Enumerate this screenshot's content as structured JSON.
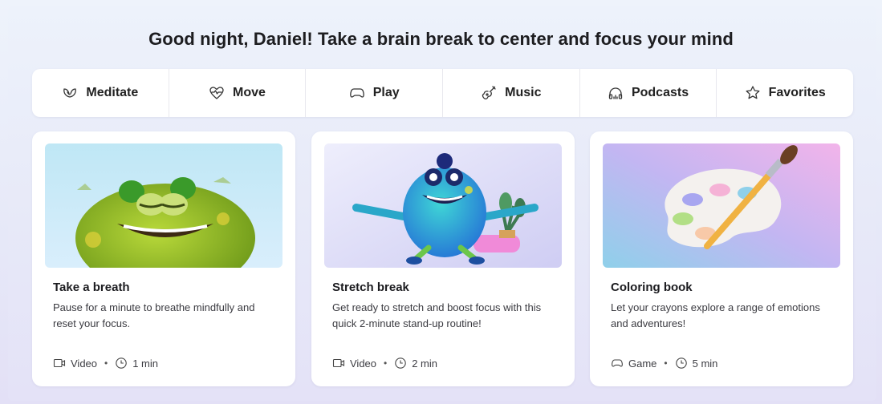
{
  "greeting": "Good night, Daniel! Take a brain break to center and focus your mind",
  "tabs": [
    {
      "label": "Meditate",
      "icon": "meditate-icon"
    },
    {
      "label": "Move",
      "icon": "heartbeat-icon"
    },
    {
      "label": "Play",
      "icon": "gamepad-icon"
    },
    {
      "label": "Music",
      "icon": "guitar-icon"
    },
    {
      "label": "Podcasts",
      "icon": "headphones-icon"
    },
    {
      "label": "Favorites",
      "icon": "star-icon"
    }
  ],
  "cards": [
    {
      "title": "Take a breath",
      "description": "Pause for a minute to breathe mindfully and reset your focus.",
      "type": "Video",
      "separator": "•",
      "duration": "1 min",
      "type_icon": "video-icon",
      "duration_icon": "clock-icon"
    },
    {
      "title": "Stretch break",
      "description": "Get ready to stretch and boost focus with this quick 2-minute stand-up routine!",
      "type": "Video",
      "separator": "•",
      "duration": "2 min",
      "type_icon": "video-icon",
      "duration_icon": "clock-icon"
    },
    {
      "title": "Coloring book",
      "description": "Let your crayons explore a range of emotions and adventures!",
      "type": "Game",
      "separator": "•",
      "duration": "5 min",
      "type_icon": "gamepad-icon",
      "duration_icon": "clock-icon"
    }
  ]
}
